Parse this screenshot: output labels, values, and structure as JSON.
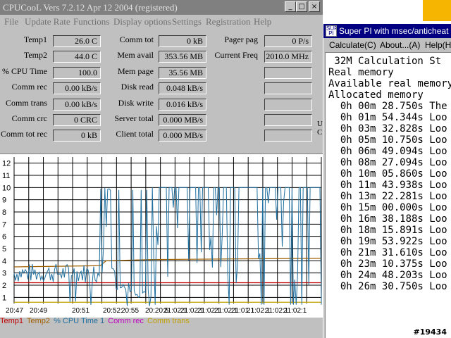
{
  "cpucool": {
    "title": "CPUCooL  Vers 7.2.12  Apr 12 2004 (registered)",
    "menu": [
      "File",
      "Update Rate",
      "Functions",
      "Display options",
      "Settings",
      "Registration",
      "Help"
    ],
    "labels": {
      "temp1": "Temp1",
      "temp2": "Temp2",
      "cpu_time": "% CPU Time",
      "comm_rec": "Comm rec",
      "comm_trans": "Comm trans",
      "comm_crc": "Comm crc",
      "comm_tot_rec": "Comm tot rec",
      "comm_tot": "Comm tot",
      "mem_avail": "Mem avail",
      "mem_page": "Mem page",
      "disk_read": "Disk read",
      "disk_write": "Disk write",
      "server_total": "Server total",
      "client_total": "Client total",
      "pager_pag": "Pager pag",
      "current_freq": "Current Freq"
    },
    "values": {
      "temp1": "26.0 C",
      "temp2": "44.0 C",
      "cpu_time": "100.0",
      "comm_rec": "0.00 kB/s",
      "comm_trans": "0.00 kB/s",
      "comm_crc": "0 CRC",
      "comm_tot_rec": "0 kB",
      "comm_tot": "0 kB",
      "mem_avail": "353.56 MB",
      "mem_page": "35.56 MB",
      "disk_read": "0.048 kB/s",
      "disk_write": "0.016 kB/s",
      "server_total": "0.000 MB/s",
      "client_total": "0.000 MB/s",
      "pager_pag": "0 P/s",
      "current_freq": "2010.0 MHz"
    },
    "side_text": [
      "U",
      "C"
    ],
    "graph": {
      "y_ticks": [
        "12",
        "11",
        "10",
        "9",
        "8",
        "7",
        "6",
        "5",
        "4",
        "3",
        "2",
        "1"
      ],
      "x_ticks": [
        "20:47",
        "20:49",
        "20:51",
        "20:52:",
        "20:55",
        "20:20:5",
        "21:02:1",
        "21:02:1",
        "21:02:1",
        "21:02:1",
        "21:01:1",
        "21:02:1",
        "21:02:1",
        "21:02:1"
      ],
      "line_colors": {
        "temp1": "#c00000",
        "temp2": "#a06000",
        "cpu": "#1f6f9f",
        "comm_rec": "#c000c0",
        "comm_trans": "#c0a000"
      }
    },
    "legend": [
      {
        "text": "Temp1",
        "color": "#c00000"
      },
      {
        "text": "Temp2",
        "color": "#a06000"
      },
      {
        "text": "% CPU Time 1",
        "color": "#1f6f9f"
      },
      {
        "text": "Comm rec",
        "color": "#c000c0"
      },
      {
        "text": "Comm trans",
        "color": "#c0a000"
      }
    ]
  },
  "superpi": {
    "title": "Super PI with msec/anticheat mod",
    "menu": [
      "Calculate(C)",
      "About...(A)",
      "Help(H)"
    ],
    "lines": [
      " 32M Calculation St",
      "Real memory",
      "Available real memory",
      "Allocated memory",
      "  0h 00m 28.750s The",
      "  0h 01m 54.344s Loo",
      "  0h 03m 32.828s Loo",
      "  0h 05m 10.750s Loo",
      "  0h 06m 49.094s Loo",
      "  0h 08m 27.094s Loo",
      "  0h 10m 05.860s Loo",
      "  0h 11m 43.938s Loo",
      "  0h 13m 22.281s Loo",
      "  0h 15m 00.000s Loo",
      "  0h 16m 38.188s Loo",
      "  0h 18m 15.891s Loo",
      "  0h 19m 53.922s Loo",
      "  0h 21m 31.610s Loo",
      "  0h 23m 10.375s Loo",
      "  0h 24m 48.203s Loo",
      "  0h 26m 30.750s Loo"
    ]
  },
  "watermark": "#19434"
}
